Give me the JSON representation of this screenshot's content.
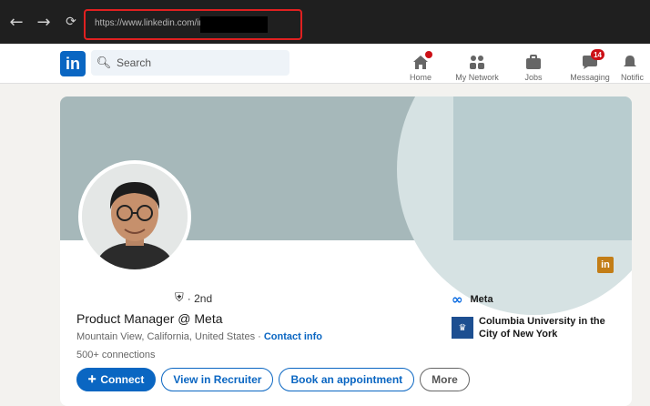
{
  "browser": {
    "back_icon": "←",
    "forward_icon": "→",
    "refresh_icon": "⟳",
    "url": "https://www.linkedin.com/in/"
  },
  "header": {
    "logo": "in",
    "search_placeholder": "Search",
    "nav": [
      {
        "label": "Home",
        "icon": "home-icon",
        "badge": ""
      },
      {
        "label": "My Network",
        "icon": "network-icon",
        "badge": ""
      },
      {
        "label": "Jobs",
        "icon": "briefcase-icon",
        "badge": ""
      },
      {
        "label": "Messaging",
        "icon": "messaging-icon",
        "badge": "14"
      },
      {
        "label": "Notific",
        "icon": "bell-icon",
        "badge": ""
      }
    ]
  },
  "profile": {
    "degree": "· 2nd",
    "headline": "Product Manager @ Meta",
    "location": "Mountain View, California, United States ·",
    "contact_info": "Contact info",
    "connections": "500+ connections",
    "buttons": {
      "connect": "Connect",
      "connect_icon": "person-plus-icon",
      "recruiter": "View in Recruiter",
      "appointment": "Book an appointment",
      "more": "More"
    },
    "company": "Meta",
    "school": "Columbia University in the City of New York",
    "linkedin_badge": "in"
  },
  "colors": {
    "brand": "#0a66c2",
    "badge": "#cc1016",
    "url_highlight": "#e02020"
  }
}
